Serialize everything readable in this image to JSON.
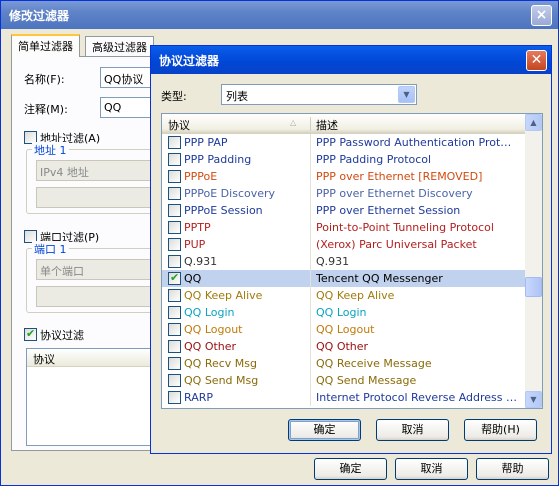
{
  "back_window": {
    "title": "修改过滤器",
    "close_glyph": "×",
    "tabs": [
      "简单过滤器",
      "高级过滤器"
    ],
    "name_label": "名称(F):",
    "name_value": "QQ协议",
    "note_label": "注释(M):",
    "note_value": "QQ",
    "addr_filter_label": "地址过滤(A)",
    "addr_group_label": "地址 1",
    "addr_type_value": "IPv4 地址",
    "port_filter_label": "端口过滤(P)",
    "port_group_label": "端口 1",
    "port_type_value": "单个端口",
    "proto_filter_label": "协议过滤",
    "proto_list_header": "协议",
    "buttons": {
      "ok": "确定",
      "cancel": "取消",
      "help": "帮助"
    }
  },
  "dialog": {
    "title": "协议过滤器",
    "close_glyph": "✕",
    "type_label": "类型:",
    "type_value": "列表",
    "col_protocol": "协议",
    "col_desc": "描述",
    "rows": [
      {
        "name": "PPP PAP",
        "desc": "PPP Password Authentication Protocol",
        "checked": false,
        "color": "#1f3a9a"
      },
      {
        "name": "PPP Padding",
        "desc": "PPP Padding Protocol",
        "checked": false,
        "color": "#1f3a9a"
      },
      {
        "name": "PPPoE",
        "desc": "PPP over Ethernet [REMOVED]",
        "checked": false,
        "color": "#d24a0f"
      },
      {
        "name": "PPPoE Discovery",
        "desc": "PPP over Ethernet Discovery",
        "checked": false,
        "color": "#4b63a6"
      },
      {
        "name": "PPPoE Session",
        "desc": "PPP over Ethernet Session",
        "checked": false,
        "color": "#1f3a9a"
      },
      {
        "name": "PPTP",
        "desc": "Point-to-Point Tunneling Protocol",
        "checked": false,
        "color": "#b41e1e"
      },
      {
        "name": "PUP",
        "desc": "(Xerox) Parc Universal Packet",
        "checked": false,
        "color": "#b41e1e"
      },
      {
        "name": "Q.931",
        "desc": "Q.931",
        "checked": false,
        "color": "#333333"
      },
      {
        "name": "QQ",
        "desc": "Tencent QQ Messenger",
        "checked": true,
        "color": "#000000",
        "selected": true
      },
      {
        "name": "QQ Keep Alive",
        "desc": "QQ Keep Alive",
        "checked": false,
        "color": "#a07a0a"
      },
      {
        "name": "QQ Login",
        "desc": "QQ Login",
        "checked": false,
        "color": "#0aa3c0"
      },
      {
        "name": "QQ Logout",
        "desc": "QQ Logout",
        "checked": false,
        "color": "#c07a0a"
      },
      {
        "name": "QQ Other",
        "desc": "QQ Other",
        "checked": false,
        "color": "#9a0f0f"
      },
      {
        "name": "QQ Recv Msg",
        "desc": "QQ Receive Message",
        "checked": false,
        "color": "#8a6a0a"
      },
      {
        "name": "QQ Send Msg",
        "desc": "QQ Send Message",
        "checked": false,
        "color": "#8a6a0a"
      },
      {
        "name": "RARP",
        "desc": "Internet Protocol Reverse Address R...",
        "checked": false,
        "color": "#1f3a9a"
      }
    ],
    "buttons": {
      "ok": "确定",
      "cancel": "取消",
      "help": "帮助(H)"
    }
  }
}
